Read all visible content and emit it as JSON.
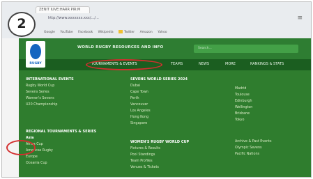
{
  "step": "2",
  "browser": {
    "tab_title": "ZENIT IUVE:HARR PIR:M",
    "address": "http://www.xxxxxxx.xxx/.../...",
    "bookmarks": [
      "Google",
      "YouTube",
      "Facebook",
      "Wikipedia",
      "Twitter",
      "Amazon",
      "Yahoo"
    ],
    "menu_icon": "menu-icon"
  },
  "site": {
    "title": "WORLD RUGBY RESOURCES AND INFO",
    "search_placeholder": "Search...",
    "logo_text": "RUGBY",
    "nav": [
      {
        "label": "TOURNAMENTS & EVENTS",
        "active": true
      },
      {
        "label": "TEAMS",
        "active": false
      },
      {
        "label": "NEWS",
        "active": false
      },
      {
        "label": "MORE",
        "active": false
      },
      {
        "label": "RANKINGS & STATS",
        "active": false
      }
    ],
    "mega": {
      "col1": {
        "head": "INTERNATIONAL EVENTS",
        "links": [
          "Rugby World Cup",
          "Sevens Series",
          "Women's Sevens",
          "U20 Championship"
        ]
      },
      "col1b": {
        "head": "REGIONAL TOURNAMENTS & SERIES",
        "links": [
          "Asia",
          "Africa Cup",
          "Americas Rugby",
          "Europe",
          "Oceania Cup"
        ]
      },
      "col2": {
        "head": "SEVENS WORLD SERIES 2024",
        "links": [
          "Dubai",
          "Cape Town",
          "Perth",
          "Vancouver",
          "Los Angeles",
          "Hong Kong",
          "Singapore"
        ]
      },
      "col2b": {
        "head": "WOMEN'S RUGBY WORLD CUP",
        "links": [
          "Fixtures & Results",
          "Pool Standings",
          "Team Profiles",
          "Venues & Tickets"
        ]
      },
      "col3": {
        "links": [
          "Madrid",
          "Toulouse",
          "Edinburgh",
          "Wellington",
          "Brisbane",
          "Tokyo"
        ]
      },
      "col3b": {
        "links": [
          "Archive & Past Events",
          "Olympic Sevens",
          "Pacific Nations"
        ]
      }
    }
  },
  "colors": {
    "header": "#2e7d32",
    "navbar": "#1b5e20",
    "mega": "#2f7d2e",
    "annotation": "#d32f2f"
  }
}
